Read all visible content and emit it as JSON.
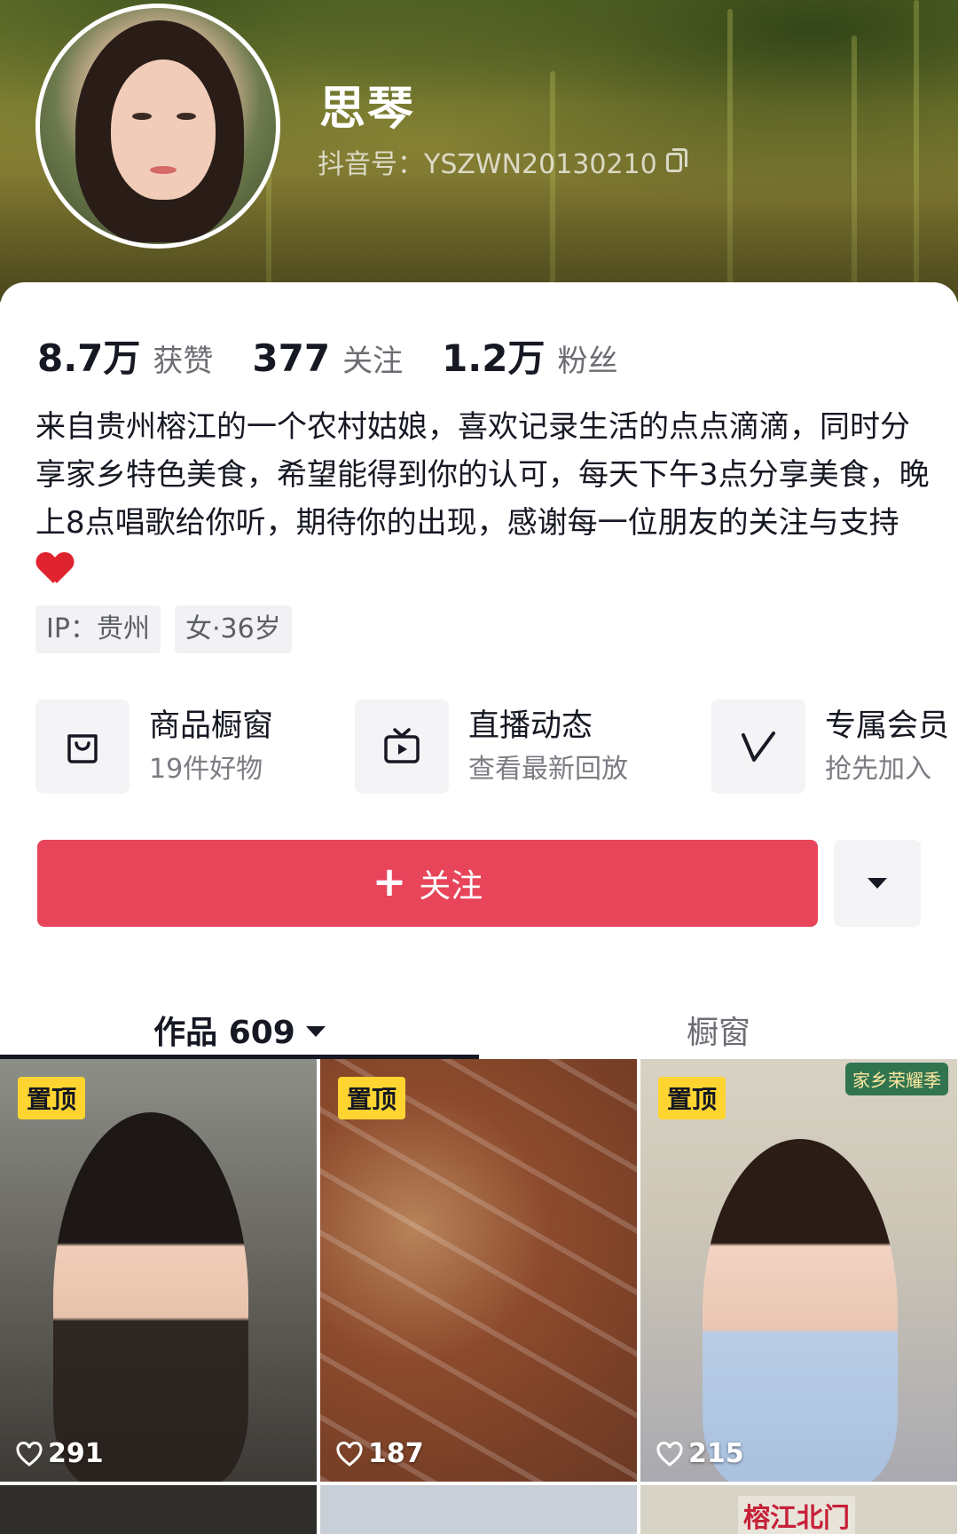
{
  "profile": {
    "name": "思琴",
    "douyin_id": "抖音号：YSZWN20130210"
  },
  "stats": [
    {
      "value": "8.7万",
      "label": "获赞"
    },
    {
      "value": "377",
      "label": "关注"
    },
    {
      "value": "1.2万",
      "label": "粉丝"
    }
  ],
  "bio": "来自贵州榕江的一个农村姑娘，喜欢记录生活的点点滴滴，同时分享家乡特色美食，希望能得到你的认可，每天下午3点分享美食，晚上8点唱歌给你听，期待你的出现，感谢每一位朋友的关注与支持",
  "bio_emoji": "heart-emoji",
  "tags": [
    "IP：贵州",
    "女·36岁"
  ],
  "features": [
    {
      "title": "商品橱窗",
      "sub": "19件好物",
      "icon": "shopping-bag-icon"
    },
    {
      "title": "直播动态",
      "sub": "查看最新回放",
      "icon": "tv-icon"
    },
    {
      "title": "专属会员",
      "sub": "抢先加入",
      "icon": "vip-v-icon"
    }
  ],
  "actions": {
    "follow_label": "关注",
    "follow_color": "#e8455a"
  },
  "tabs": {
    "works": "作品 609",
    "showcase": "橱窗"
  },
  "videos": [
    {
      "pinned": "置顶",
      "likes": "291"
    },
    {
      "pinned": "置顶",
      "likes": "187"
    },
    {
      "pinned": "置顶",
      "likes": "215",
      "badge": "家乡荣耀季"
    },
    {},
    {},
    {
      "sign": "榕江北门"
    }
  ]
}
